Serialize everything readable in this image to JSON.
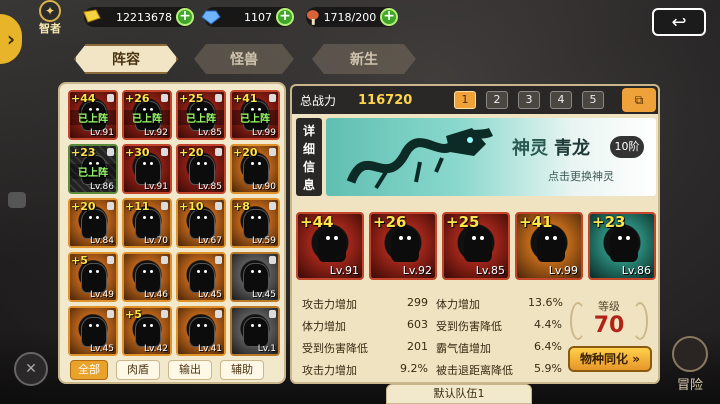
{
  "header": {
    "advisor_label": "智者",
    "resources": [
      {
        "icon": "gold-coins-icon",
        "value": "12213678",
        "color": "#f5d442"
      },
      {
        "icon": "blue-crystal-icon",
        "value": "1107",
        "color": "#6fb4ff"
      },
      {
        "icon": "meat-drumstick-icon",
        "value": "1718/200",
        "color": "#d9643a"
      }
    ],
    "back_icon": "return-arrow-icon"
  },
  "tabs": [
    {
      "label": "阵容",
      "active": true
    },
    {
      "label": "怪兽",
      "active": false
    },
    {
      "label": "新生",
      "active": false
    }
  ],
  "roster": [
    {
      "stars": "+44",
      "level": "Lv.91",
      "status": "已上阵",
      "frame": "red"
    },
    {
      "stars": "+26",
      "level": "Lv.92",
      "status": "已上阵",
      "frame": "red"
    },
    {
      "stars": "+25",
      "level": "Lv.85",
      "status": "已上阵",
      "frame": "red"
    },
    {
      "stars": "+41",
      "level": "Lv.99",
      "status": "已上阵",
      "frame": "red"
    },
    {
      "stars": "+23",
      "level": "Lv.86",
      "status": "已上阵",
      "frame": "green"
    },
    {
      "stars": "+30",
      "level": "Lv.91",
      "status": "",
      "frame": "red"
    },
    {
      "stars": "+20",
      "level": "Lv.85",
      "status": "",
      "frame": "red"
    },
    {
      "stars": "+20",
      "level": "Lv.90",
      "status": "",
      "frame": "orange"
    },
    {
      "stars": "+20",
      "level": "Lv.84",
      "status": "",
      "frame": "orange"
    },
    {
      "stars": "+11",
      "level": "Lv.70",
      "status": "",
      "frame": "orange"
    },
    {
      "stars": "+10",
      "level": "Lv.67",
      "status": "",
      "frame": "orange"
    },
    {
      "stars": "+8",
      "level": "Lv.59",
      "status": "",
      "frame": "orange"
    },
    {
      "stars": "+5",
      "level": "Lv.49",
      "status": "",
      "frame": "orange"
    },
    {
      "stars": "",
      "level": "Lv.46",
      "status": "",
      "frame": "orange"
    },
    {
      "stars": "",
      "level": "Lv.45",
      "status": "",
      "frame": "orange"
    },
    {
      "stars": "",
      "level": "Lv.45",
      "status": "",
      "frame": "gray"
    },
    {
      "stars": "",
      "level": "Lv.45",
      "status": "",
      "frame": "orange"
    },
    {
      "stars": "+5",
      "level": "Lv.42",
      "status": "",
      "frame": "orange"
    },
    {
      "stars": "",
      "level": "Lv.41",
      "status": "",
      "frame": "orange"
    },
    {
      "stars": "",
      "level": "Lv.1",
      "status": "",
      "frame": "gray"
    }
  ],
  "filters": [
    {
      "label": "全部",
      "active": true
    },
    {
      "label": "肉盾",
      "active": false
    },
    {
      "label": "输出",
      "active": false
    },
    {
      "label": "辅助",
      "active": false
    }
  ],
  "team": {
    "power_label": "总战力",
    "power_value": "116720",
    "pages": [
      "1",
      "2",
      "3",
      "4",
      "5"
    ],
    "active_page": "1",
    "detail_label": "详细信息",
    "spirit_label": "神灵",
    "spirit_name": "青龙",
    "spirit_rank": "10阶",
    "change_hint": "点击更换神灵",
    "slots": [
      {
        "stars": "+44",
        "level": "Lv.91",
        "tone": "red"
      },
      {
        "stars": "+26",
        "level": "Lv.92",
        "tone": "red"
      },
      {
        "stars": "+25",
        "level": "Lv.85",
        "tone": "red"
      },
      {
        "stars": "+41",
        "level": "Lv.99",
        "tone": "orange"
      },
      {
        "stars": "+23",
        "level": "Lv.86",
        "tone": "cyan"
      }
    ],
    "stats": [
      {
        "name": "攻击力增加",
        "value": "299"
      },
      {
        "name": "体力增加",
        "value": "13.6%"
      },
      {
        "name": "体力增加",
        "value": "603"
      },
      {
        "name": "受到伤害降低",
        "value": "4.4%"
      },
      {
        "name": "受到伤害降低",
        "value": "201"
      },
      {
        "name": "霸气值增加",
        "value": "6.4%"
      },
      {
        "name": "攻击力增加",
        "value": "9.2%"
      },
      {
        "name": "被击退距离降低",
        "value": "5.9%"
      }
    ],
    "level_label": "等级",
    "level_value": "70",
    "sync_label": "物种同化",
    "default_team_label": "默认队伍1"
  },
  "adventure_label": "冒险"
}
